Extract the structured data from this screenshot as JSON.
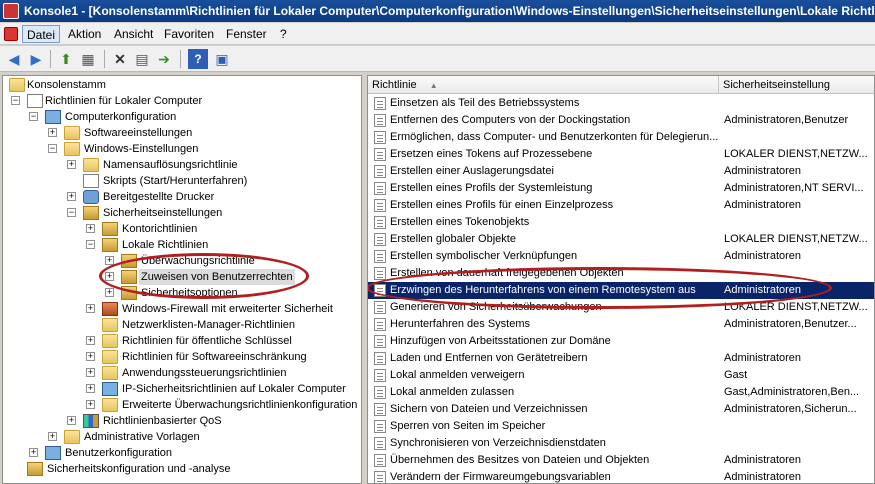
{
  "window": {
    "title": "Konsole1 - [Konsolenstamm\\Richtlinien für Lokaler Computer\\Computerkonfiguration\\Windows-Einstellungen\\Sicherheitseinstellungen\\Lokale Richtlin"
  },
  "menu": {
    "items": [
      "Datei",
      "Aktion",
      "Ansicht",
      "Favoriten",
      "Fenster",
      "?"
    ]
  },
  "toolbar": {
    "icons": [
      "back-icon",
      "forward-icon",
      "up-icon",
      "show-hide-tree-icon",
      "delete-icon",
      "properties-icon",
      "export-icon",
      "help-icon",
      "console-icon"
    ]
  },
  "tree": {
    "nodes": [
      {
        "label": "Konsolenstamm",
        "icon": "folder-icon",
        "expander": ""
      },
      {
        "label": "Richtlinien für Lokaler Computer",
        "icon": "policy-doc-icon",
        "expander": "−"
      },
      {
        "label": "Computerkonfiguration",
        "icon": "computer-icon",
        "expander": "−"
      },
      {
        "label": "Softwareeinstellungen",
        "icon": "folder-icon",
        "expander": "+"
      },
      {
        "label": "Windows-Einstellungen",
        "icon": "folder-icon",
        "expander": "−"
      },
      {
        "label": "Namensauflösungsrichtlinie",
        "icon": "folder-icon",
        "expander": "+"
      },
      {
        "label": "Skripts (Start/Herunterfahren)",
        "icon": "script-doc-icon",
        "expander": ""
      },
      {
        "label": "Bereitgestellte Drucker",
        "icon": "printer-icon",
        "expander": "+"
      },
      {
        "label": "Sicherheitseinstellungen",
        "icon": "security-icon",
        "expander": "−"
      },
      {
        "label": "Kontorichtlinien",
        "icon": "security-folder-icon",
        "expander": "+"
      },
      {
        "label": "Lokale Richtlinien",
        "icon": "security-folder-icon",
        "expander": "−"
      },
      {
        "label": "Überwachungsrichtlinie",
        "icon": "security-folder-icon",
        "expander": "+"
      },
      {
        "label": "Zuweisen von Benutzerrechten",
        "icon": "security-folder-icon",
        "expander": "+",
        "selected": true
      },
      {
        "label": "Sicherheitsoptionen",
        "icon": "security-folder-icon",
        "expander": "+"
      },
      {
        "label": "Windows-Firewall mit erweiterter Sicherheit",
        "icon": "firewall-icon",
        "expander": "+"
      },
      {
        "label": "Netzwerklisten-Manager-Richtlinien",
        "icon": "folder-icon",
        "expander": ""
      },
      {
        "label": "Richtlinien für öffentliche Schlüssel",
        "icon": "folder-icon",
        "expander": "+"
      },
      {
        "label": "Richtlinien für Softwareeinschränkung",
        "icon": "folder-icon",
        "expander": "+"
      },
      {
        "label": "Anwendungssteuerungsrichtlinien",
        "icon": "folder-icon",
        "expander": "+"
      },
      {
        "label": "IP-Sicherheitsrichtlinien auf Lokaler Computer",
        "icon": "ip-security-icon",
        "expander": "+"
      },
      {
        "label": "Erweiterte Überwachungsrichtlinienkonfiguration",
        "icon": "folder-icon",
        "expander": "+"
      },
      {
        "label": "Richtlinienbasierter QoS",
        "icon": "qos-chart-icon",
        "expander": "+"
      },
      {
        "label": "Administrative Vorlagen",
        "icon": "folder-icon",
        "expander": "+"
      },
      {
        "label": "Benutzerkonfiguration",
        "icon": "user-icon",
        "expander": "+"
      },
      {
        "label": "Sicherheitskonfiguration und -analyse",
        "icon": "security-analysis-icon",
        "expander": ""
      }
    ]
  },
  "list": {
    "columns": [
      "Richtlinie",
      "Sicherheitseinstellung"
    ],
    "rows": [
      {
        "name": "Einsetzen als Teil des Betriebssystems",
        "value": ""
      },
      {
        "name": "Entfernen des Computers von der Dockingstation",
        "value": "Administratoren,Benutzer"
      },
      {
        "name": "Ermöglichen, dass Computer- und Benutzerkonten für Delegierun...",
        "value": ""
      },
      {
        "name": "Ersetzen eines Tokens auf Prozessebene",
        "value": "LOKALER DIENST,NETZW..."
      },
      {
        "name": "Erstellen einer Auslagerungsdatei",
        "value": "Administratoren"
      },
      {
        "name": "Erstellen eines Profils der Systemleistung",
        "value": "Administratoren,NT SERVI..."
      },
      {
        "name": "Erstellen eines Profils für einen Einzelprozess",
        "value": "Administratoren"
      },
      {
        "name": "Erstellen eines Tokenobjekts",
        "value": ""
      },
      {
        "name": "Erstellen globaler Objekte",
        "value": "LOKALER DIENST,NETZW..."
      },
      {
        "name": "Erstellen symbolischer Verknüpfungen",
        "value": "Administratoren"
      },
      {
        "name": "Erstellen von dauerhaft freigegebenen Objekten",
        "value": ""
      },
      {
        "name": "Erzwingen des Herunterfahrens von einem Remotesystem aus",
        "value": "Administratoren",
        "selected": true
      },
      {
        "name": "Generieren von Sicherheitsüberwachungen",
        "value": "LOKALER DIENST,NETZW..."
      },
      {
        "name": "Herunterfahren des Systems",
        "value": "Administratoren,Benutzer..."
      },
      {
        "name": "Hinzufügen von Arbeitsstationen zur Domäne",
        "value": ""
      },
      {
        "name": "Laden und Entfernen von Gerätetreibern",
        "value": "Administratoren"
      },
      {
        "name": "Lokal anmelden verweigern",
        "value": "Gast"
      },
      {
        "name": "Lokal anmelden zulassen",
        "value": "Gast,Administratoren,Ben..."
      },
      {
        "name": "Sichern von Dateien und Verzeichnissen",
        "value": "Administratoren,Sicherun..."
      },
      {
        "name": "Sperren von Seiten im Speicher",
        "value": ""
      },
      {
        "name": "Synchronisieren von Verzeichnisdienstdaten",
        "value": ""
      },
      {
        "name": "Übernehmen des Besitzes von Dateien und Objekten",
        "value": "Administratoren"
      },
      {
        "name": "Verändern der Firmwareumgebungsvariablen",
        "value": "Administratoren"
      }
    ]
  },
  "colors": {
    "title_bar": "#0a3a7f",
    "selection": "#0a246a",
    "annotation": "#b11f1f"
  }
}
